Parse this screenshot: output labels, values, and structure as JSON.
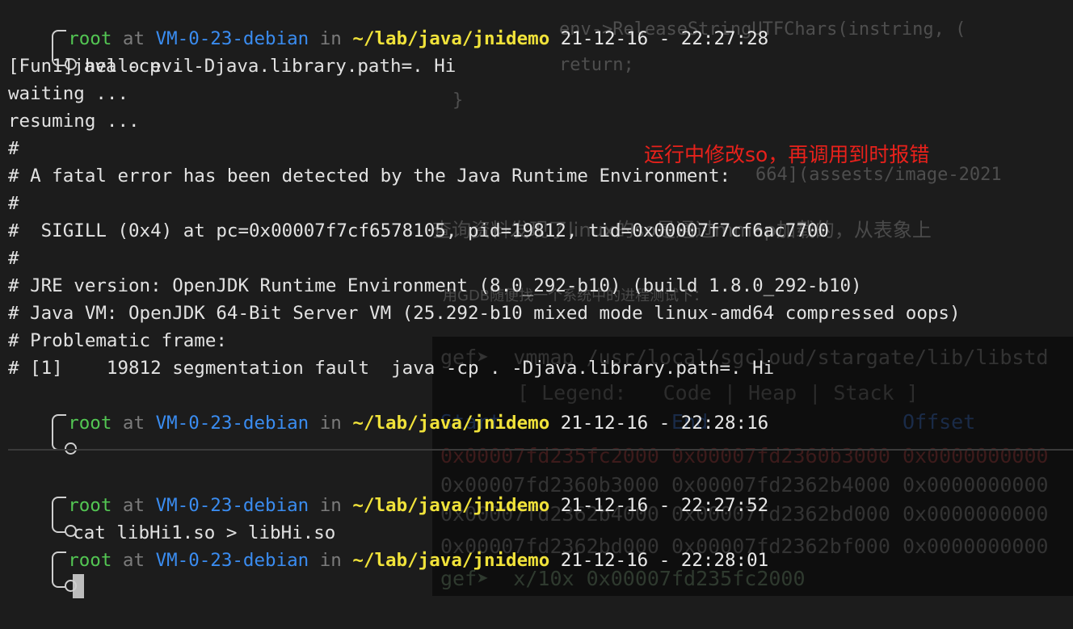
{
  "background": {
    "code_lines": [
      "env->ReleaseStringUTFChars(instring, (",
      "return;",
      "}"
    ],
    "doc_link": "664](assests/image-2021",
    "doc_text_1": "查询资料发现了linux的so是通过mmap加载的，从表象上",
    "doc_text_2": "用GDB随便找一个系统中的进程测试下：",
    "gef_lines": [
      "gef➤  vmmap /usr/local/sgcloud/stargate/lib/libstd",
      "[ Legend:   Code | Heap | Stack ]",
      "Start              End                Offset",
      "0x00007fd235fc2000 0x00007fd2360b3000 0x0000000000",
      "0x00007fd2360b3000 0x00007fd2362b4000 0x0000000000",
      "0x00007fd2362b4000 0x00007fd2362bd000 0x0000000000",
      "0x00007fd2362bd000 0x00007fd2362bf000 0x0000000000",
      "gef➤  x/10x 0x00007fd235fc2000"
    ]
  },
  "annotation": "运行中修改so，再调用到时报错",
  "top_terminal": {
    "prompt1": {
      "user": "root",
      "at": "at",
      "host": "VM-0-23-debian",
      "in": "in",
      "path": "~/lab/java/jnidemo",
      "time": "21-12-16 - 22:27:28"
    },
    "command1": "java -cp . -Djava.library.path=. Hi",
    "output": [
      "[Fun1] hello evil",
      "waiting ...",
      "resuming ...",
      "#",
      "# A fatal error has been detected by the Java Runtime Environment:",
      "#",
      "#  SIGILL (0x4) at pc=0x00007f7cf6578105, pid=19812, tid=0x00007f7cf6ac7700",
      "#",
      "# JRE version: OpenJDK Runtime Environment (8.0_292-b10) (build 1.8.0_292-b10)",
      "# Java VM: OpenJDK 64-Bit Server VM (25.292-b10 mixed mode linux-amd64 compressed oops)",
      "# Problematic frame:",
      "# [1]    19812 segmentation fault  java -cp . -Djava.library.path=. Hi"
    ],
    "prompt2": {
      "user": "root",
      "at": "at",
      "host": "VM-0-23-debian",
      "in": "in",
      "path": "~/lab/java/jnidemo",
      "time": "21-12-16 - 22:28:16"
    }
  },
  "bottom_terminal": {
    "prompt1": {
      "user": "root",
      "at": "at",
      "host": "VM-0-23-debian",
      "in": "in",
      "path": "~/lab/java/jnidemo",
      "time": "21-12-16 - 22:27:52"
    },
    "command1": "cat libHi1.so > libHi.so",
    "prompt2": {
      "user": "root",
      "at": "at",
      "host": "VM-0-23-debian",
      "in": "in",
      "path": "~/lab/java/jnidemo",
      "time": "21-12-16 - 22:28:01"
    }
  }
}
